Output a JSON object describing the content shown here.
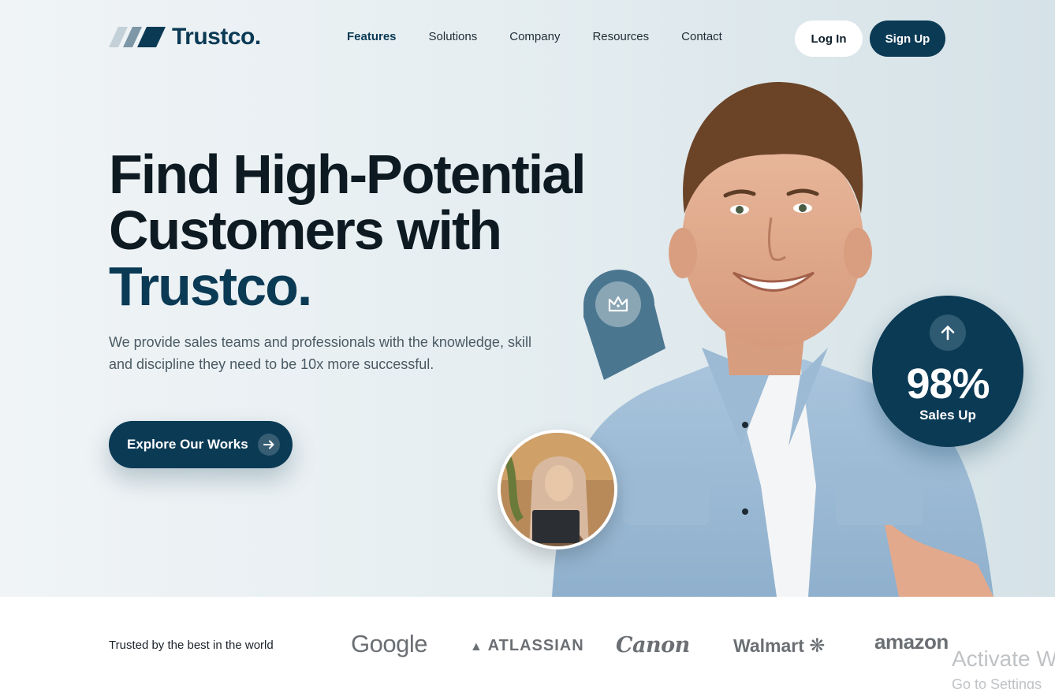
{
  "brand": {
    "name": "Trustco.",
    "color": "#0b3a55"
  },
  "nav": {
    "items": [
      {
        "label": "Features",
        "active": true
      },
      {
        "label": "Solutions",
        "active": false
      },
      {
        "label": "Company",
        "active": false
      },
      {
        "label": "Resources",
        "active": false
      },
      {
        "label": "Contact",
        "active": false
      }
    ],
    "login_label": "Log In",
    "signup_label": "Sign Up"
  },
  "hero": {
    "headline_line1": "Find High-Potential",
    "headline_line2": "Customers with",
    "headline_accent": "Trustco.",
    "subtext": "We provide sales teams and professionals with the knowledge, skill and discipline they need to be 10x more successful.",
    "cta_label": "Explore Our Works",
    "cta_icon": "arrow-right-icon",
    "crown_icon": "crown-icon",
    "stat": {
      "value": "98%",
      "label": "Sales Up",
      "icon": "arrow-up-icon"
    }
  },
  "trust": {
    "text": "Trusted by the best in the world",
    "brands": [
      "Google",
      "ATLASSIAN",
      "Canon",
      "Walmart",
      "amazon"
    ]
  },
  "overlay": {
    "activate_title": "Activate W",
    "activate_sub": "Go to Settings"
  }
}
